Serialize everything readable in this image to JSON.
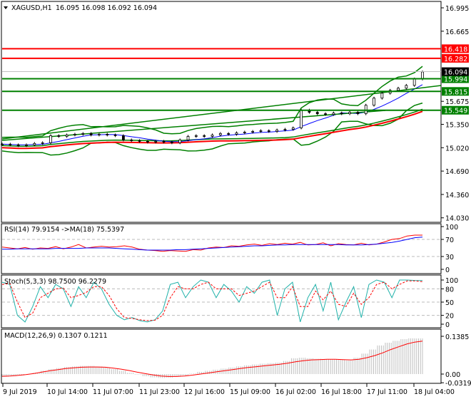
{
  "header": {
    "symbol_label": "XAGUSD,H1",
    "ohlc": "16.095 16.098 16.092 16.094"
  },
  "colors": {
    "bull_line": "#008000",
    "bear_line": "#ff0000",
    "current": "#000000",
    "rsi": "#ff0000",
    "rsi_ma": "#0000ff",
    "stoch_main": "#20b2aa",
    "stoch_signal": "#ff0000",
    "macd_hist": "#c0c0c0",
    "macd_signal": "#ff0000"
  },
  "chart_data": [
    {
      "type": "line",
      "title": "XAGUSD,H1",
      "ylim": [
        14.03,
        16.995
      ],
      "yticks": [
        "16.995",
        "16.665",
        "15.675",
        "15.350",
        "15.020",
        "14.690",
        "14.360",
        "14.030"
      ],
      "ytick_values": [
        16.995,
        16.665,
        15.675,
        15.35,
        15.02,
        14.69,
        14.36,
        14.03
      ],
      "x_labels": [
        "9 Jul 2019",
        "10 Jul 14:00",
        "11 Jul 07:00",
        "11 Jul 23:00",
        "12 Jul 16:00",
        "15 Jul 09:00",
        "16 Jul 02:00",
        "16 Jul 18:00",
        "17 Jul 11:00",
        "18 Jul 04:00"
      ],
      "close": [
        15.07,
        15.06,
        15.05,
        15.06,
        15.08,
        15.09,
        15.19,
        15.18,
        15.2,
        15.21,
        15.22,
        15.2,
        15.21,
        15.2,
        15.19,
        15.13,
        15.12,
        15.11,
        15.1,
        15.11,
        15.1,
        15.09,
        15.13,
        15.18,
        15.19,
        15.18,
        15.2,
        15.22,
        15.21,
        15.23,
        15.24,
        15.25,
        15.26,
        15.25,
        15.27,
        15.28,
        15.3,
        15.55,
        15.52,
        15.5,
        15.49,
        15.51,
        15.5,
        15.52,
        15.5,
        15.62,
        15.72,
        15.79,
        15.83,
        15.86,
        15.9,
        15.99,
        16.09
      ],
      "levels": [
        {
          "label": "16.418",
          "value": 16.418,
          "kind": "resistance"
        },
        {
          "label": "16.282",
          "value": 16.282,
          "kind": "resistance"
        },
        {
          "label": "15.994",
          "value": 15.994,
          "kind": "support"
        },
        {
          "label": "15.815",
          "value": 15.815,
          "kind": "support"
        },
        {
          "label": "15.549",
          "value": 15.549,
          "kind": "support"
        }
      ],
      "current_price": {
        "label": "16.094",
        "value": 16.094
      }
    },
    {
      "type": "line",
      "title": "RSI(14) 79.9154  ->MA(18) 75.5397",
      "ylim": [
        0,
        100
      ],
      "yticks": [
        "100",
        "70",
        "30",
        "0"
      ],
      "ytick_values": [
        100,
        70,
        30,
        0
      ],
      "rsi": [
        52,
        50,
        48,
        51,
        47,
        50,
        49,
        53,
        48,
        52,
        58,
        50,
        52,
        54,
        52,
        53,
        55,
        52,
        47,
        45,
        44,
        42,
        44,
        43,
        42,
        46,
        45,
        50,
        52,
        51,
        55,
        54,
        57,
        59,
        56,
        60,
        58,
        61,
        59,
        63,
        57,
        58,
        62,
        55,
        60,
        58,
        57,
        61,
        57,
        59,
        64,
        70,
        72,
        78,
        80,
        80
      ],
      "ma": [
        47,
        47,
        48,
        48,
        48,
        48,
        48,
        49,
        49,
        49,
        49,
        50,
        50,
        50,
        50,
        49,
        48,
        47,
        46,
        45,
        45,
        45,
        45,
        46,
        46,
        47,
        48,
        49,
        50,
        51,
        52,
        53,
        54,
        55,
        55,
        56,
        57,
        57,
        58,
        58,
        58,
        58,
        58,
        58,
        58,
        57,
        57,
        57,
        58,
        59,
        61,
        63,
        66,
        70,
        74,
        75.5
      ]
    },
    {
      "type": "line",
      "title": "Stoch(5,3,3) 98.7500 96.2279",
      "ylim": [
        0,
        100
      ],
      "yticks": [
        "100",
        "80",
        "50",
        "20",
        "0"
      ],
      "ytick_values": [
        100,
        80,
        50,
        20,
        0
      ],
      "main": [
        95,
        90,
        20,
        5,
        40,
        85,
        60,
        90,
        80,
        40,
        85,
        60,
        95,
        80,
        45,
        20,
        10,
        15,
        8,
        5,
        10,
        30,
        90,
        95,
        60,
        85,
        100,
        95,
        60,
        90,
        75,
        50,
        85,
        70,
        95,
        100,
        20,
        80,
        95,
        5,
        60,
        90,
        30,
        95,
        10,
        50,
        85,
        15,
        90,
        100,
        95,
        60,
        100,
        100,
        99,
        98.75
      ],
      "signal": [
        90,
        92,
        50,
        15,
        25,
        60,
        70,
        80,
        82,
        60,
        65,
        72,
        85,
        85,
        65,
        35,
        15,
        13,
        10,
        8,
        9,
        20,
        60,
        85,
        80,
        80,
        90,
        95,
        80,
        80,
        80,
        65,
        70,
        75,
        85,
        95,
        60,
        60,
        85,
        40,
        40,
        75,
        55,
        75,
        45,
        40,
        70,
        45,
        60,
        90,
        95,
        80,
        90,
        98,
        98,
        96.23
      ]
    },
    {
      "type": "bar",
      "title": "MACD(12,26,9) 0.1307 0.1211",
      "ylim": [
        -0.0319,
        0.1385
      ],
      "yticks": [
        "0.1385",
        "0.00",
        "-0.0319"
      ],
      "ytick_values": [
        0.1385,
        0,
        -0.0319
      ],
      "histogram": [
        -0.01,
        -0.008,
        -0.005,
        0.0,
        0.005,
        0.012,
        0.018,
        0.022,
        0.026,
        0.028,
        0.03,
        0.03,
        0.028,
        0.024,
        0.018,
        0.012,
        0.005,
        -0.002,
        -0.008,
        -0.012,
        -0.014,
        -0.013,
        -0.01,
        -0.005,
        0.002,
        0.008,
        0.012,
        0.016,
        0.02,
        0.024,
        0.028,
        0.032,
        0.035,
        0.038,
        0.04,
        0.042,
        0.048,
        0.058,
        0.06,
        0.058,
        0.056,
        0.055,
        0.054,
        0.052,
        0.05,
        0.06,
        0.075,
        0.09,
        0.105,
        0.115,
        0.122,
        0.128,
        0.131,
        0.1307
      ],
      "signal": [
        -0.008,
        -0.007,
        -0.005,
        -0.002,
        0.002,
        0.007,
        0.012,
        0.016,
        0.02,
        0.023,
        0.025,
        0.026,
        0.026,
        0.025,
        0.022,
        0.018,
        0.013,
        0.007,
        0.002,
        -0.003,
        -0.007,
        -0.009,
        -0.009,
        -0.007,
        -0.004,
        0.0,
        0.004,
        0.008,
        0.012,
        0.016,
        0.02,
        0.024,
        0.027,
        0.03,
        0.033,
        0.036,
        0.04,
        0.045,
        0.049,
        0.052,
        0.053,
        0.054,
        0.054,
        0.053,
        0.052,
        0.054,
        0.06,
        0.068,
        0.078,
        0.09,
        0.1,
        0.11,
        0.117,
        0.1211
      ]
    }
  ]
}
